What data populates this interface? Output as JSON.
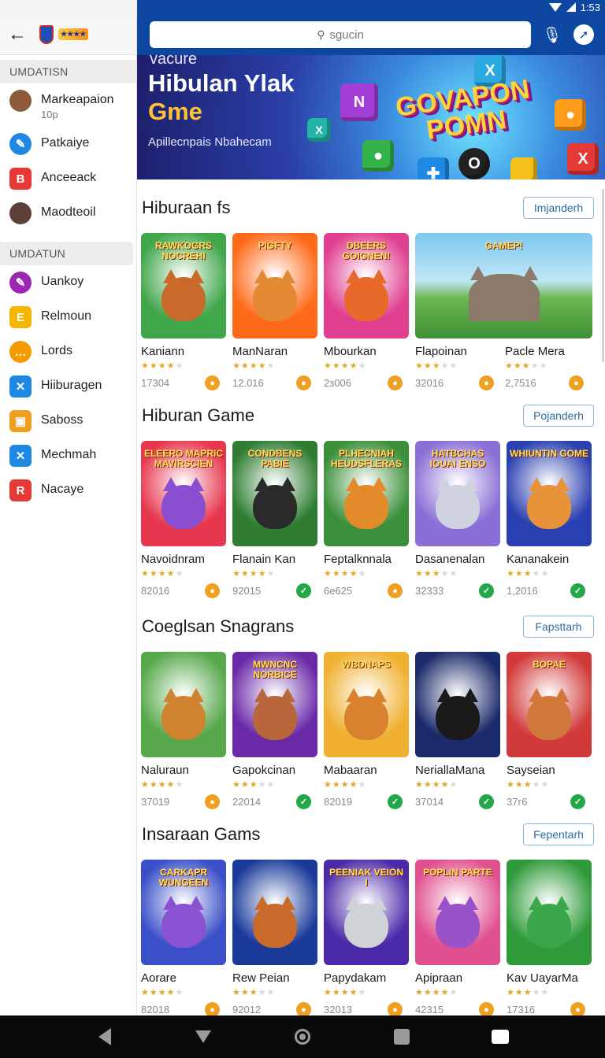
{
  "status": {
    "time": "1:53"
  },
  "sidebar": {
    "section1": "UMDATISN",
    "section2": "UMDATUN",
    "items1": [
      {
        "label": "Markeapaion",
        "sub": "10p",
        "icon": "avatar-icon",
        "color": "#8d5a3b"
      },
      {
        "label": "Patkaiye",
        "sub": "",
        "icon": "pen-icon",
        "color": "#1e88e5"
      },
      {
        "label": "Anceeack",
        "sub": "",
        "icon": "b-square-icon",
        "color": "#e53935"
      },
      {
        "label": "Maodteoil",
        "sub": "",
        "icon": "character-icon",
        "color": "#5d4037"
      }
    ],
    "items2": [
      {
        "label": "Uankoy",
        "icon": "pen-circle-icon",
        "color": "#9c27b0"
      },
      {
        "label": "Relmoun",
        "icon": "e-square-icon",
        "color": "#f4b400"
      },
      {
        "label": "Lords",
        "icon": "chat-icon",
        "color": "#f59b00"
      },
      {
        "label": "Hiiburagen",
        "icon": "x-square-icon",
        "color": "#1e88e5"
      },
      {
        "label": "Saboss",
        "icon": "box-icon",
        "color": "#f0a020"
      },
      {
        "label": "Mechmah",
        "icon": "x-square-icon",
        "color": "#1e88e5"
      },
      {
        "label": "Nacaye",
        "icon": "r-square-icon",
        "color": "#e53935"
      }
    ]
  },
  "search": {
    "placeholder": "sgucin"
  },
  "banner": {
    "kicker": "vacure",
    "title_line1": "Hibulan Ylak",
    "title_line2": "Gme",
    "subtitle": "Apillecnpais Nbahecam",
    "art_text_1": "GOVAPON",
    "art_text_2": "POMN"
  },
  "sections": [
    {
      "title": "Hiburaan fs",
      "button": "Imjanderh",
      "cards": [
        {
          "name": "Kaniann",
          "count": "17304",
          "badge": "coin",
          "cap": "RAWKOGRS NOCREHI",
          "bg": "#3fa64a",
          "critter": "#c96a2a",
          "rating": 4,
          "wide": false
        },
        {
          "name": "ManNaran",
          "count": "12.016",
          "badge": "coin",
          "cap": "PIGFTY",
          "bg": "#ff6a1a",
          "critter": "#e58a34",
          "rating": 4,
          "wide": false
        },
        {
          "name": "Mbourkan",
          "count": "2з006",
          "badge": "coin",
          "cap": "DBEERS GOIGNEN!",
          "bg": "#e0408f",
          "critter": "#e86a2a",
          "rating": 4,
          "wide": false
        },
        {
          "name": "Flapoinan",
          "count": "32016",
          "badge": "coin",
          "cap": "GAMEP!",
          "bg": "#58a84a",
          "critter": "#8a7a6a",
          "rating": 3,
          "wide": true
        },
        {
          "name": "Pacle Mera",
          "count": "2,7516",
          "badge": "coin",
          "cap": "",
          "bg": "#58a84a",
          "critter": "#8a7a6a",
          "rating": 3,
          "wide": false
        }
      ]
    },
    {
      "title": "Hiburan Game",
      "button": "Pojanderh",
      "cards": [
        {
          "name": "Navoidnram",
          "count": "82016",
          "badge": "coin",
          "cap": "ELEERO MAPRIC MAVIRSCIEN",
          "bg": "#e7374f",
          "critter": "#8a4fd0",
          "rating": 4,
          "wide": false
        },
        {
          "name": "Flanain Kan",
          "count": "92015",
          "badge": "check",
          "cap": "CONDBENS PABIE",
          "bg": "#2e7d32",
          "critter": "#2a2a2a",
          "rating": 4,
          "wide": false
        },
        {
          "name": "Feptalknnala",
          "count": "6е625",
          "badge": "coin",
          "cap": "PLHECNIAH HEUDSFLERAS",
          "bg": "#3b8f3a",
          "critter": "#e38a2a",
          "rating": 4,
          "wide": false
        },
        {
          "name": "Dasanenalan",
          "count": "32333",
          "badge": "check",
          "cap": "HATBCHAS IOUAI ENSO",
          "bg": "#8a6fd6",
          "critter": "#cfd3e0",
          "rating": 3,
          "wide": false
        },
        {
          "name": "Kananakein",
          "count": "1,2016",
          "badge": "check",
          "cap": "WHIUNTIN GOME",
          "bg": "#2a3fb0",
          "critter": "#e8923a",
          "rating": 3,
          "wide": false
        }
      ]
    },
    {
      "title": "Coeglsan Snagrans",
      "button": "Fapsttarh",
      "cards": [
        {
          "name": "Naluraun",
          "count": "37019",
          "badge": "coin",
          "cap": "",
          "bg": "#56a84a",
          "critter": "#d0832e",
          "rating": 4,
          "wide": false
        },
        {
          "name": "Gapokcinan",
          "count": "22014",
          "badge": "check",
          "cap": "MWNCNC NORBICE",
          "bg": "#6a2aa8",
          "critter": "#b8663a",
          "rating": 3,
          "wide": false
        },
        {
          "name": "Mabaaran",
          "count": "82019",
          "badge": "check",
          "cap": "WBDNAPS",
          "bg": "#f0b030",
          "critter": "#d8822e",
          "rating": 4,
          "wide": false
        },
        {
          "name": "NeriallaMana",
          "count": "37014",
          "badge": "check",
          "cap": "",
          "bg": "#1b2a6a",
          "critter": "#1a1a1a",
          "rating": 4,
          "wide": false
        },
        {
          "name": "Sayseian",
          "count": "37г6",
          "badge": "check",
          "cap": "BOPAE",
          "bg": "#d23a3a",
          "critter": "#d0773a",
          "rating": 3,
          "wide": false
        }
      ]
    },
    {
      "title": "Insaraan Gams",
      "button": "Fepentarh",
      "cards": [
        {
          "name": "Aorare",
          "count": "82018",
          "badge": "coin",
          "cap": "CARKAPR WUNGEEN",
          "bg": "#3a4fc8",
          "critter": "#8a52d0",
          "rating": 4,
          "wide": false
        },
        {
          "name": "Rew Peian",
          "count": "92012",
          "badge": "coin",
          "cap": "",
          "bg": "#1a3a9a",
          "critter": "#c86a2a",
          "rating": 3,
          "wide": false
        },
        {
          "name": "Papydakam",
          "count": "32013",
          "badge": "coin",
          "cap": "PEENIAK VEION I",
          "bg": "#4a2aa8",
          "critter": "#cfd3d8",
          "rating": 4,
          "wide": false
        },
        {
          "name": "Apipraan",
          "count": "42315",
          "badge": "coin",
          "cap": "POPLIN PARTE",
          "bg": "#e0508f",
          "critter": "#9a52c8",
          "rating": 4,
          "wide": false
        },
        {
          "name": "Kav UayarMa",
          "count": "17316",
          "badge": "coin",
          "cap": "",
          "bg": "#2e9a3a",
          "critter": "#3aa84a",
          "rating": 3,
          "wide": false
        }
      ]
    }
  ]
}
